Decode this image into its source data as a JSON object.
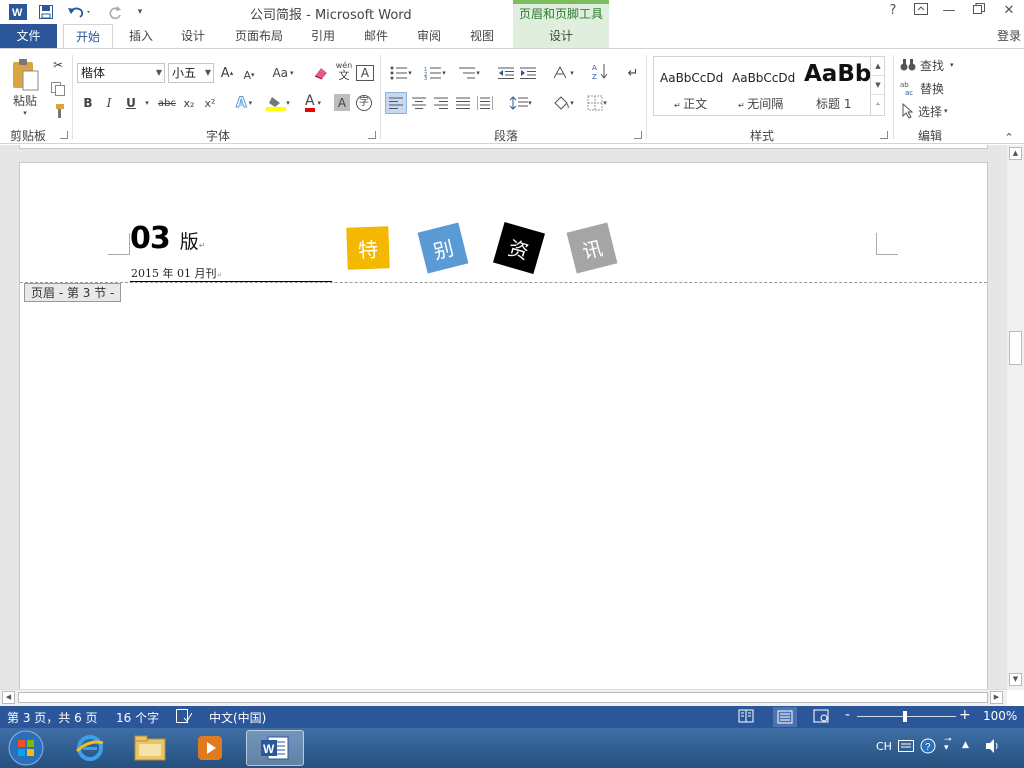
{
  "window": {
    "title": "公司简报 - Microsoft Word",
    "context_tab_group": "页眉和页脚工具",
    "help": "?",
    "signin": "登录"
  },
  "tabs": [
    "文件",
    "开始",
    "插入",
    "设计",
    "页面布局",
    "引用",
    "邮件",
    "审阅",
    "视图",
    "设计"
  ],
  "ribbon": {
    "clipboard": {
      "paste": "粘贴",
      "label": "剪贴板"
    },
    "font": {
      "family": "楷体",
      "size": "小五",
      "label": "字体",
      "grow": "A",
      "shrink": "A",
      "case": "Aa",
      "bold": "B",
      "italic": "I",
      "underline": "U",
      "strike": "abc",
      "subscript": "x₂",
      "superscript": "x²",
      "font_color_letter": "A",
      "phonetic": "wén",
      "char_border": "A",
      "char_shading": "A",
      "enclose": "字"
    },
    "paragraph": {
      "label": "段落"
    },
    "styles": {
      "label": "样式",
      "items": [
        {
          "preview": "AaBbCcDd",
          "name": "正文"
        },
        {
          "preview": "AaBbCcDd",
          "name": "无间隔"
        },
        {
          "preview": "AaBb",
          "name": "标题 1"
        }
      ]
    },
    "editing": {
      "label": "编辑",
      "find": "查找",
      "replace": "替换",
      "select": "选择"
    }
  },
  "document": {
    "issue_number": "03",
    "issue_suffix": "版",
    "date_line": "2015 年 01 月刊",
    "header_tag": "页眉 - 第 3 节 -",
    "tiles": [
      {
        "char": "特",
        "bg": "#f5b800",
        "color": "#ffffff"
      },
      {
        "char": "别",
        "bg": "#5b9bd5",
        "color": "#ffffff"
      },
      {
        "char": "资",
        "bg": "#000000",
        "color": "#ffffff"
      },
      {
        "char": "讯",
        "bg": "#a5a5a5",
        "color": "#ffffff"
      }
    ]
  },
  "status": {
    "page": "第 3 页，共 6 页",
    "words": "16 个字",
    "language": "中文(中国)",
    "zoom": "100%",
    "zoom_minus": "-",
    "zoom_plus": "+"
  },
  "taskbar": {
    "lang": "CH"
  },
  "colors": {
    "accent": "#2b579a",
    "context": "#dfeedd",
    "context_text": "#2e7a32"
  }
}
